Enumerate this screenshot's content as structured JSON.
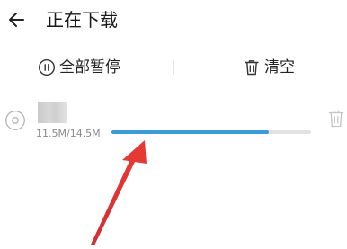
{
  "header": {
    "title": "正在下载",
    "back_icon": "arrow-left-icon"
  },
  "toolbar": {
    "pause_all_label": "全部暂停",
    "pause_icon": "pause-circle-icon",
    "clear_label": "清空",
    "clear_icon": "trash-icon"
  },
  "download": {
    "icon": "disc-icon",
    "size_text": "11.5M/14.5M",
    "progress": 0.79,
    "delete_icon": "trash-icon"
  },
  "colors": {
    "progress_fill": "#3b9ad9",
    "progress_track": "#e2e2e2",
    "annotation_arrow": "#e53935"
  }
}
